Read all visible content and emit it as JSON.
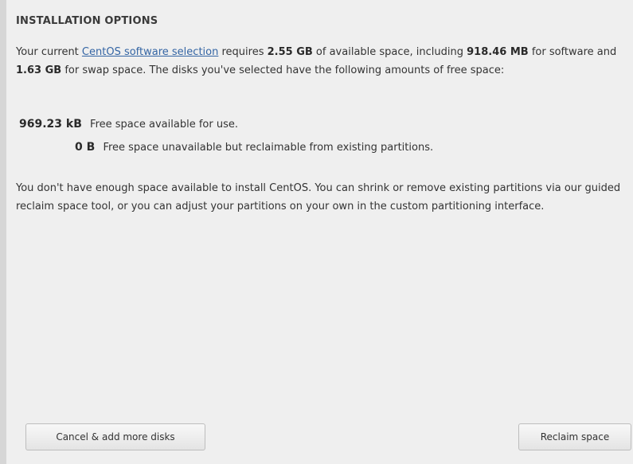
{
  "dialog": {
    "title": "INSTALLATION OPTIONS",
    "p1": {
      "pre_link": "Your current ",
      "link": "CentOS software selection",
      "after_link": " requires ",
      "required_total": "2.55 GB",
      "after_total": " of available space, including ",
      "software_size": "918.46 MB",
      "after_software": " for software and ",
      "swap_size": "1.63 GB",
      "after_swap": " for swap space. The disks you've selected have the following amounts of free space:"
    },
    "free_space": {
      "available_value": "969.23 kB",
      "available_label": "Free space available for use.",
      "reclaimable_value": "0 B",
      "reclaimable_label": "Free space unavailable but reclaimable from existing partitions."
    },
    "p2": "You don't have enough space available to install CentOS.  You can shrink or remove existing partitions via our guided reclaim space tool, or you can adjust your partitions on your own in the custom partitioning interface.",
    "buttons": {
      "cancel": "Cancel & add more disks",
      "reclaim": "Reclaim space"
    }
  }
}
